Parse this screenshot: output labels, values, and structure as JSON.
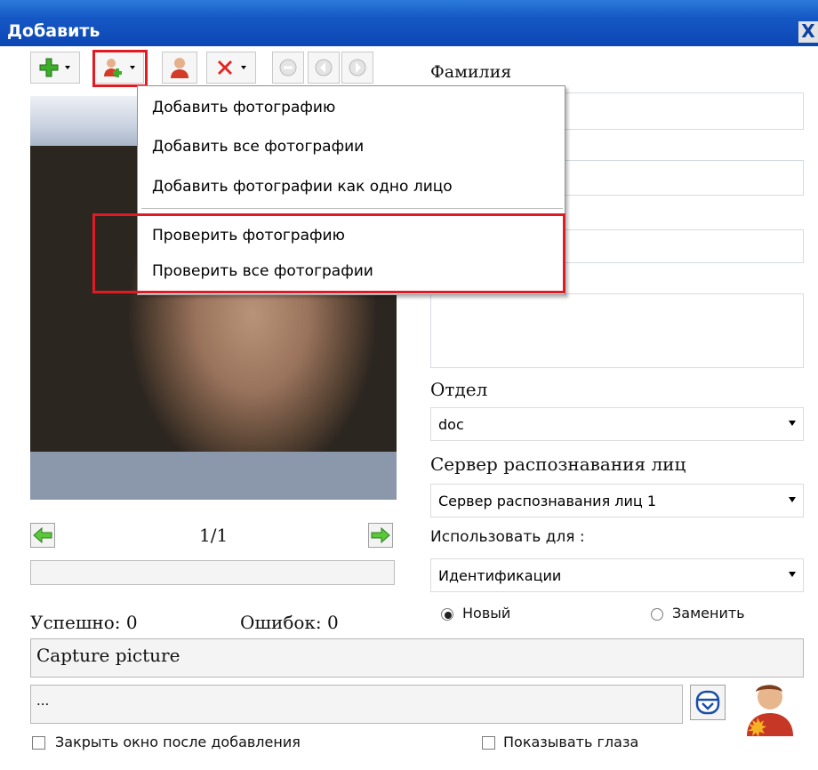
{
  "window": {
    "title": "Добавить",
    "close_glyph": "X"
  },
  "toolbar": {
    "icons": [
      "add-icon",
      "person-add-icon",
      "person-icon",
      "delete-icon",
      "minus-icon",
      "back-icon",
      "forward-icon"
    ]
  },
  "menu": {
    "items": [
      "Добавить фотографию",
      "Добавить все фотографии",
      "Добавить фотографии как одно лицо",
      "Проверить фотографию",
      "Проверить все фотографии"
    ]
  },
  "form": {
    "surname_label": "Фамилия",
    "department_label": "Отдел",
    "department_value": "doc",
    "server_label": "Сервер распознавания лиц",
    "server_value": "Сервер распознавания лиц 1",
    "use_for_label": "Использовать для :",
    "use_for_value": "Идентификации",
    "radio_new": "Новый",
    "radio_replace": "Заменить"
  },
  "photo_panel": {
    "page_indicator": "1/1",
    "success_label": "Успешно: 0",
    "errors_label": "Ошибок: 0"
  },
  "bottom": {
    "capture_text": "Capture picture",
    "path_text": "...",
    "close_after_add": "Закрыть окно после добавления",
    "show_eyes": "Показывать глаза"
  },
  "colors": {
    "titlebar": "#0c47b4",
    "highlight_red": "#e01b24"
  }
}
